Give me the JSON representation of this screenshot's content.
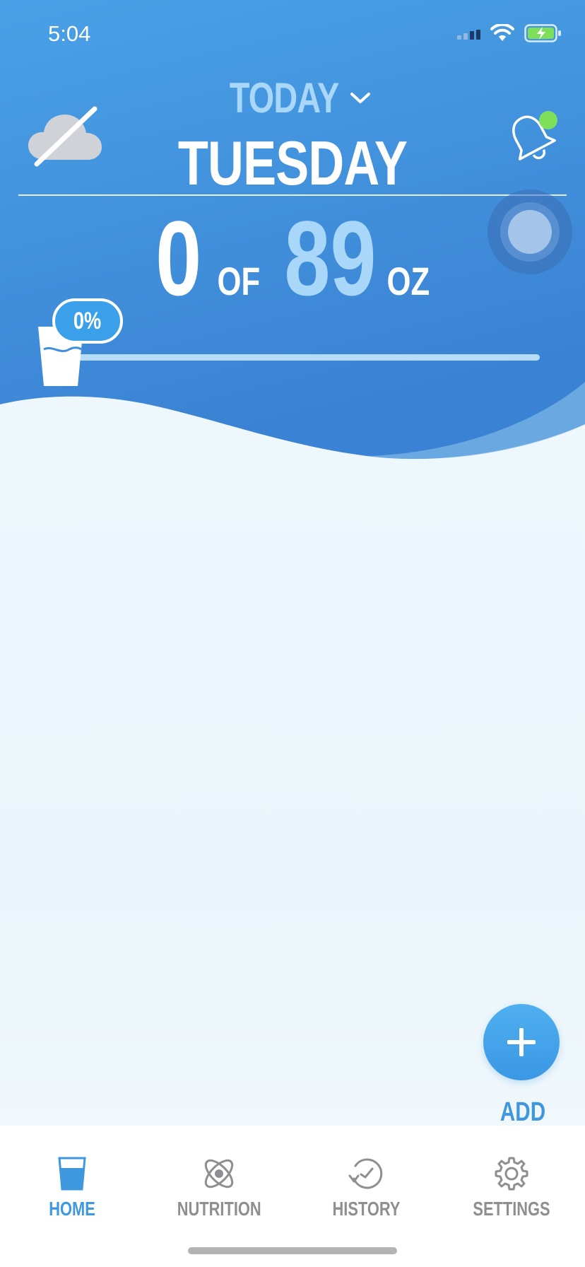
{
  "status_bar": {
    "time": "5:04",
    "icons": [
      "cellular-signal-icon",
      "wifi-icon",
      "battery-charging-icon"
    ]
  },
  "header": {
    "period_label": "TODAY",
    "day_label": "TUESDAY",
    "weather_icon": "cloud-off-icon",
    "reminder_icon": "bell-icon",
    "reminder_dot_color": "#7ee05a"
  },
  "intake": {
    "current": "0",
    "separator": "OF",
    "goal": "89",
    "unit": "OZ",
    "percent_label": "0%",
    "progress": 0
  },
  "add_drink": {
    "label": "ADD DRINK",
    "icon": "plus-icon"
  },
  "tabs": [
    {
      "label": "HOME",
      "icon": "water-glass-icon",
      "active": true
    },
    {
      "label": "NUTRITION",
      "icon": "atom-icon",
      "active": false
    },
    {
      "label": "HISTORY",
      "icon": "history-clock-icon",
      "active": false
    },
    {
      "label": "SETTINGS",
      "icon": "gear-icon",
      "active": false
    }
  ],
  "colors": {
    "header_blue": "#3f8fdc",
    "accent_light": "#a9d7f9",
    "tab_active": "#3f98dd",
    "tab_inactive": "#8e8e93"
  }
}
